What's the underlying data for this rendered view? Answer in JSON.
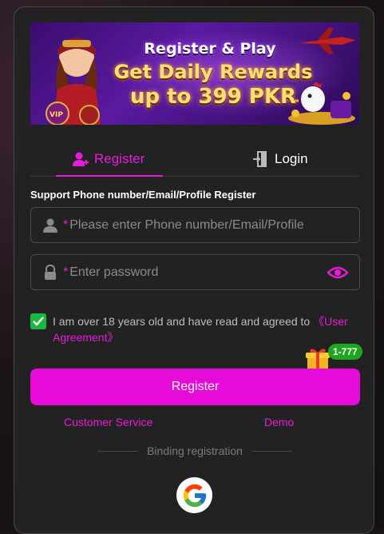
{
  "banner": {
    "line1": "Register & Play",
    "line2": "Get Daily Rewards",
    "line3": "up to 399 PKR",
    "vip_text": "VIP"
  },
  "tabs": [
    {
      "label": "Register",
      "icon": "add-user-icon",
      "active": true
    },
    {
      "label": "Login",
      "icon": "login-door-icon",
      "active": false
    }
  ],
  "form": {
    "support_text": "Support Phone number/Email/Profile Register",
    "phone": {
      "required_mark": "*",
      "placeholder": "Please enter Phone number/Email/Profile",
      "value": ""
    },
    "password": {
      "required_mark": "*",
      "placeholder": "Enter password",
      "value": ""
    },
    "agreement": {
      "checked": true,
      "text": "I am over 18 years old and have read and agreed to ",
      "link": "《User Agreement》"
    },
    "bonus_badge": "1-777",
    "submit_label": "Register"
  },
  "links": {
    "customer_service": "Customer Service",
    "demo": "Demo"
  },
  "binding_label": "Binding registration",
  "social": [
    {
      "icon": "google-icon",
      "name": "Google"
    }
  ],
  "colors": {
    "accent": "#e81bd9",
    "checkbox": "#19b843",
    "badge": "#1ea71e",
    "panel": "#232223"
  }
}
